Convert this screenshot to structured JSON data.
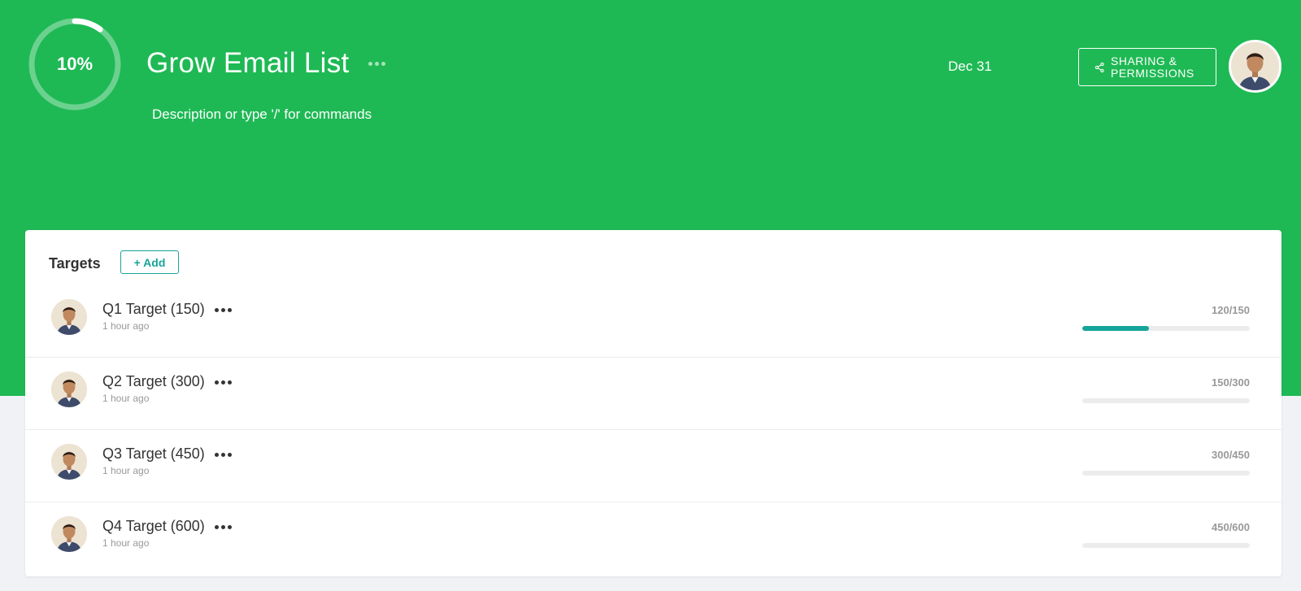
{
  "goal": {
    "progress_label": "10%",
    "progress_fraction": 0.1,
    "title": "Grow Email List",
    "description_placeholder": "Description or type '/' for commands",
    "due_date": "Dec 31",
    "share_label_line1": "SHARING &",
    "share_label_line2": "PERMISSIONS"
  },
  "targets": {
    "heading": "Targets",
    "add_label": "+ Add",
    "items": [
      {
        "name": "Q1 Target (150)",
        "time": "1 hour ago",
        "value_text": "120/150",
        "progress": 0.4
      },
      {
        "name": "Q2 Target (300)",
        "time": "1 hour ago",
        "value_text": "150/300",
        "progress": 0
      },
      {
        "name": "Q3 Target (450)",
        "time": "1 hour ago",
        "value_text": "300/450",
        "progress": 0
      },
      {
        "name": "Q4 Target (600)",
        "time": "1 hour ago",
        "value_text": "450/600",
        "progress": 0
      }
    ]
  },
  "colors": {
    "header_green": "#1eb954",
    "accent_teal": "#17a49a"
  },
  "icons": {
    "share": "share-icon",
    "menu": "more-dots-icon",
    "avatar": "user-avatar"
  }
}
